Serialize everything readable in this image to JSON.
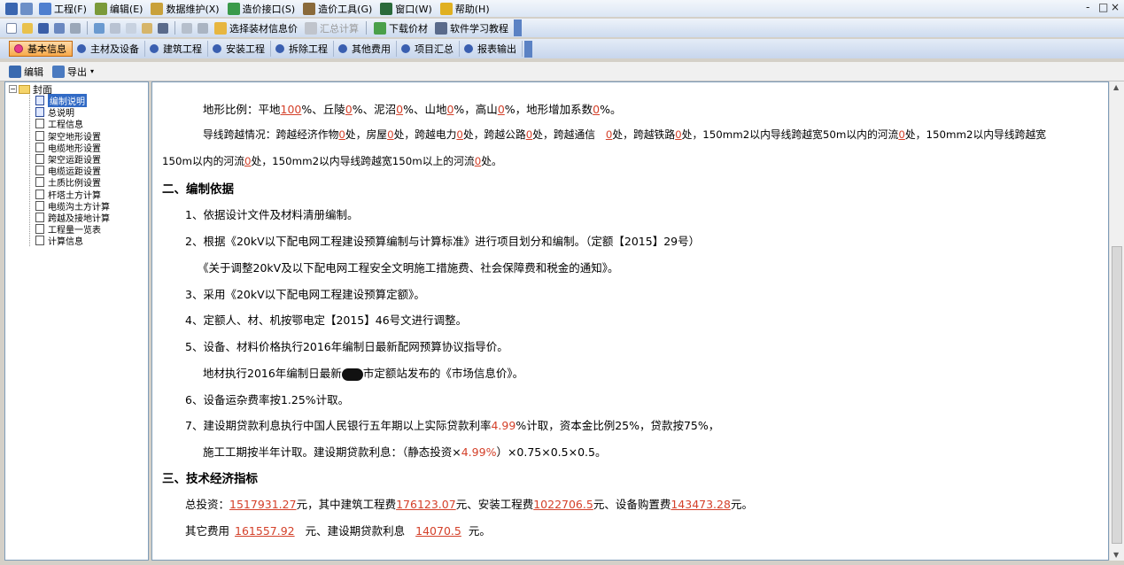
{
  "menubar": {
    "items": [
      {
        "label": "工程(F)",
        "icon": "project-icon"
      },
      {
        "label": "编辑(E)",
        "icon": "edit-icon"
      },
      {
        "label": "数据维护(X)",
        "icon": "data-maintain-icon"
      },
      {
        "label": "造价接口(S)",
        "icon": "cost-interface-icon"
      },
      {
        "label": "造价工具(G)",
        "icon": "cost-tool-icon"
      },
      {
        "label": "窗口(W)",
        "icon": "window-icon"
      },
      {
        "label": "帮助(H)",
        "icon": "help-icon"
      }
    ],
    "window_controls": [
      "-",
      "□",
      "×"
    ]
  },
  "toolbar1": {
    "select_material_price": "选择装材信息价",
    "summary": "汇总计算",
    "download_price": "下载价材",
    "tutorial": "软件学习教程"
  },
  "tabs": [
    {
      "label": "基本信息",
      "active": true
    },
    {
      "label": "主材及设备",
      "active": false
    },
    {
      "label": "建筑工程",
      "active": false
    },
    {
      "label": "安装工程",
      "active": false
    },
    {
      "label": "拆除工程",
      "active": false
    },
    {
      "label": "其他费用",
      "active": false
    },
    {
      "label": "项目汇总",
      "active": false
    },
    {
      "label": "报表输出",
      "active": false
    }
  ],
  "toolbar2": {
    "edit_label": "编辑",
    "export_label": "导出"
  },
  "tree": {
    "root_label": "封面",
    "items": [
      {
        "label": "编制说明",
        "selected": true
      },
      {
        "label": "总说明",
        "selected": false
      },
      {
        "label": "工程信息",
        "selected": false
      },
      {
        "label": "架空地形设置",
        "selected": false
      },
      {
        "label": "电缆地形设置",
        "selected": false
      },
      {
        "label": "架空运距设置",
        "selected": false
      },
      {
        "label": "电缆运距设置",
        "selected": false
      },
      {
        "label": "土质比例设置",
        "selected": false
      },
      {
        "label": "杆塔土方计算",
        "selected": false
      },
      {
        "label": "电缆沟土方计算",
        "selected": false
      },
      {
        "label": "跨越及接地计算",
        "selected": false
      },
      {
        "label": "工程量一览表",
        "selected": false
      },
      {
        "label": "计算信息",
        "selected": false
      }
    ]
  },
  "document": {
    "terrain": {
      "label": "地形比例：",
      "plain_label": "平地",
      "plain_value": "100",
      "hill_label": "%、丘陵",
      "hill_value": "0",
      "mud_label": "%、泥沼",
      "mud_value": "0",
      "mountain_label": "%、山地",
      "mountain_value": "0",
      "high_label": "%，高山",
      "high_value": "0",
      "add_label": "%，地形增加系数",
      "add_value": "0",
      "end": "%。"
    },
    "crossing": {
      "label": "导线跨越情况：",
      "crop_label": "跨越经济作物",
      "crop_value": "0",
      "house_label": "处，房屋",
      "house_value": "0",
      "power_label": "处，跨越电力",
      "power_value": "0",
      "road_label": "处，跨越公路",
      "road_value": "0",
      "comm_label": "处，跨越通信　",
      "comm_value": "0",
      "rail_label": "处，跨越铁路",
      "rail_value": "0",
      "river50_label": "处，150mm2以内导线跨越宽50m以内的河流",
      "river50_value": "0",
      "river150_label": "处，150mm2以内导线跨越宽",
      "river150_cont": "150m以内的河流",
      "river150_value": "0",
      "river150p_label": "处，150mm2以内导线跨越宽150m以上的河流",
      "river150p_value": "0",
      "end": "处。"
    },
    "basis": {
      "heading": "二、编制依据",
      "b1": "1、依据设计文件及材料清册编制。",
      "b2": "2、根据《20kV以下配电网工程建设预算编制与计算标准》进行项目划分和编制。（定额【2015】29号）",
      "b2b": "《关于调整20kV及以下配电网工程安全文明施工措施费、社会保障费和税金的通知》。",
      "b3": "3、采用《20kV以下配电网工程建设预算定额》。",
      "b4": "4、定额人、材、机按鄂电定【2015】46号文进行调整。",
      "b5": "5、设备、材料价格执行2016年编制日最新配网预算协议指导价。",
      "b5b_pre": "地材执行2016年编制日最新",
      "b5b_post": "市定额站发布的《市场信息价》。",
      "b6": "6、设备运杂费率按1.25%计取。",
      "b7_pre": "7、建设期贷款利息执行中国人民银行五年期以上实际贷款利率",
      "b7_rate": "4.99",
      "b7_post": "%计取，资本金比例25%，贷款按75%，",
      "b7b_pre": "施工工期按半年计取。建设期贷款利息：（静态投资×",
      "b7b_rate": "4.99%",
      "b7b_post": "）×0.75×0.5×0.5。"
    },
    "indicators": {
      "heading": "三、技术经济指标",
      "total_label": "总投资：",
      "total_value": "1517931.27",
      "building_label": "元，其中建筑工程费",
      "building_value": "176123.07",
      "install_label": "元、安装工程费",
      "install_value": "1022706.5",
      "equipment_label": "元、设备购置费",
      "equipment_value": "143473.28",
      "end1": "元。",
      "other_label": "其它费用",
      "other_value": "161557.92",
      "interest_label": "元、建设期贷款利息",
      "interest_value": "14070.5",
      "end2": "元。"
    }
  }
}
